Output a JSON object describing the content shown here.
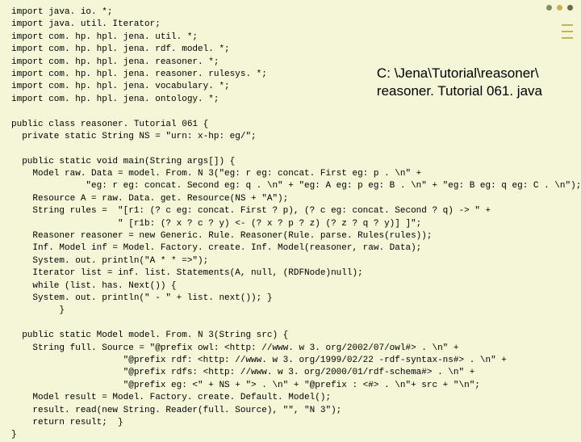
{
  "file_path_line1": "C: \\Jena\\Tutorial\\reasoner\\",
  "file_path_line2": "reasoner. Tutorial 061. java",
  "code_lines": [
    "import java. io. *;",
    "import java. util. Iterator;",
    "import com. hp. hpl. jena. util. *;",
    "import com. hp. hpl. jena. rdf. model. *;",
    "import com. hp. hpl. jena. reasoner. *;",
    "import com. hp. hpl. jena. reasoner. rulesys. *;",
    "import com. hp. hpl. jena. vocabulary. *;",
    "import com. hp. hpl. jena. ontology. *;",
    "",
    "public class reasoner. Tutorial 061 {",
    "  private static String NS = \"urn: x-hp: eg/\";",
    "",
    "  public static void main(String args[]) {",
    "    Model raw. Data = model. From. N 3(\"eg: r eg: concat. First eg: p . \\n\" +",
    "              \"eg: r eg: concat. Second eg: q . \\n\" + \"eg: A eg: p eg: B . \\n\" + \"eg: B eg: q eg: C . \\n\");",
    "    Resource A = raw. Data. get. Resource(NS + \"A\");",
    "    String rules =  \"[r1: (? c eg: concat. First ? p), (? c eg: concat. Second ? q) -> \" +",
    "                    \" [r1b: (? x ? c ? y) <- (? x ? p ? z) (? z ? q ? y)] ]\";",
    "    Reasoner reasoner = new Generic. Rule. Reasoner(Rule. parse. Rules(rules));",
    "    Inf. Model inf = Model. Factory. create. Inf. Model(reasoner, raw. Data);",
    "    System. out. println(\"A * * =>\");",
    "    Iterator list = inf. list. Statements(A, null, (RDFNode)null);",
    "    while (list. has. Next()) {",
    "    System. out. println(\" - \" + list. next()); }",
    "         }",
    "",
    "  public static Model model. From. N 3(String src) {",
    "    String full. Source = \"@prefix owl: <http: //www. w 3. org/2002/07/owl#> . \\n\" +",
    "                     \"@prefix rdf: <http: //www. w 3. org/1999/02/22 -rdf-syntax-ns#> . \\n\" +",
    "                     \"@prefix rdfs: <http: //www. w 3. org/2000/01/rdf-schema#> . \\n\" +",
    "                     \"@prefix eg: <\" + NS + \"> . \\n\" + \"@prefix : <#> . \\n\"+ src + \"\\n\";",
    "    Model result = Model. Factory. create. Default. Model();",
    "    result. read(new String. Reader(full. Source), \"\", \"N 3\");",
    "    return result;  }",
    "}"
  ]
}
